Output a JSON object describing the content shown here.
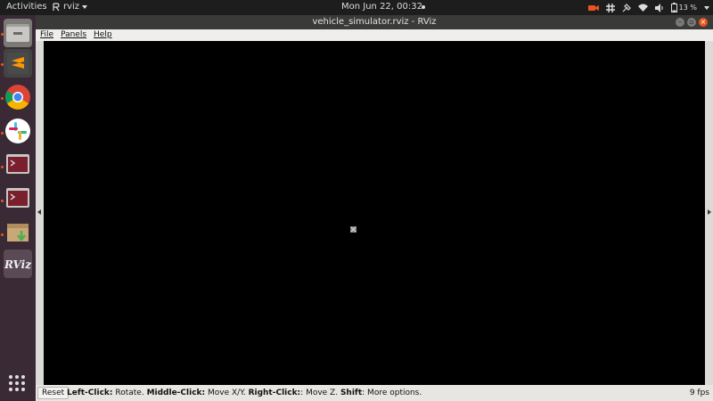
{
  "topbar": {
    "activities": "Activities",
    "app_name": "rviz",
    "clock": "Mon Jun 22, 00:32",
    "battery": "13 %"
  },
  "window": {
    "title": "vehicle_simulator.rviz - RViz"
  },
  "menu": {
    "file": "File",
    "panels": "Panels",
    "help": "Help"
  },
  "statusbar": {
    "reset": "Reset",
    "left_click": "Left-Click:",
    "left_click_desc": " Rotate. ",
    "middle_click": "Middle-Click:",
    "middle_click_desc": " Move X/Y. ",
    "right_click": "Right-Click:",
    "right_click_desc": ": Move Z. ",
    "shift": "Shift",
    "shift_desc": ": More options.",
    "fps": "9 fps"
  },
  "dock": {
    "items": [
      "files-icon",
      "sublime-text-icon",
      "chrome-icon",
      "slack-icon",
      "terminal-icon",
      "terminal-icon",
      "software-updater-icon",
      "rviz-icon"
    ],
    "rviz_label": "RViz"
  },
  "colors": {
    "accent": "#e95420",
    "viewport_bg": "#000000",
    "dock_bg": "#3a2a35"
  }
}
